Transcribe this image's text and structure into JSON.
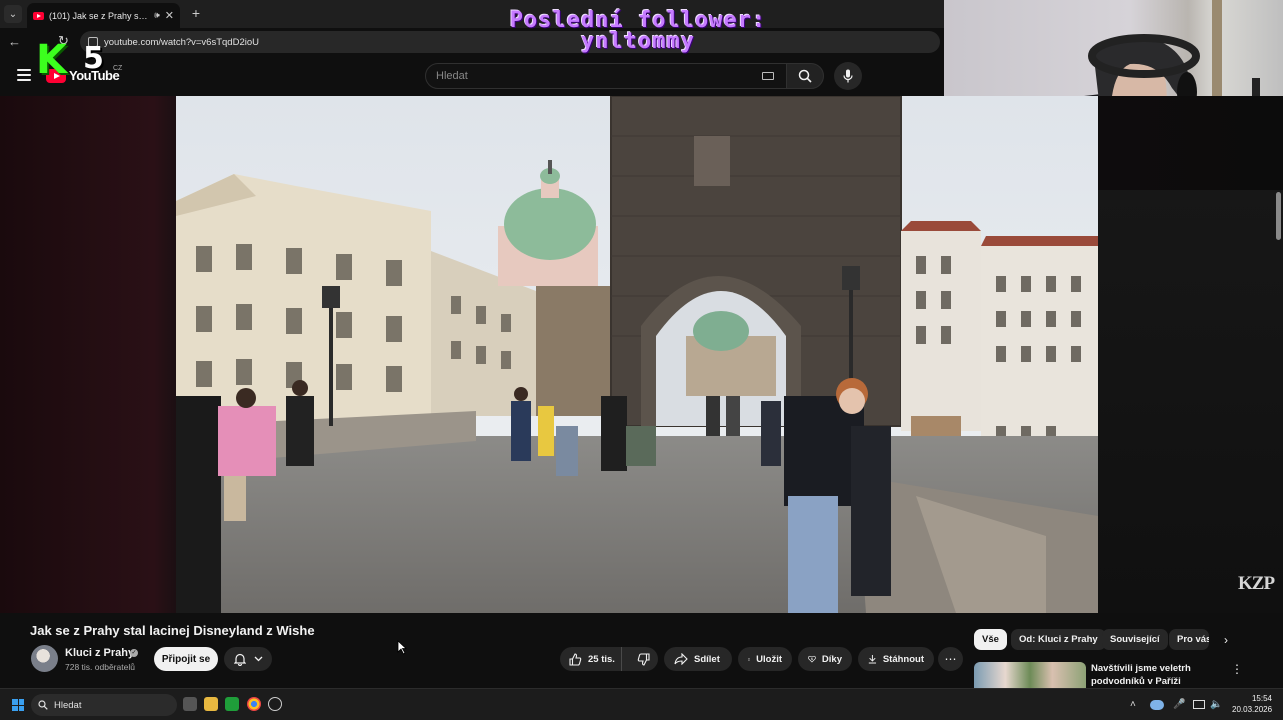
{
  "browser": {
    "tab": {
      "title": "(101) Jak se z Prahy stal lacinej Disneyland z Wishe"
    },
    "url": "youtube.com/watch?v=v6sTqdD2ioU"
  },
  "youtube": {
    "logo_text": "YouTube",
    "region": "CZ",
    "search_placeholder": "Hledat"
  },
  "overlay": {
    "k5_letters": [
      "K",
      "5"
    ],
    "follower_line1": "Poslední follower:",
    "follower_line2": "ynltommy"
  },
  "video": {
    "watermark": "KZP",
    "title": "Jak se z Prahy stal lacinej Disneyland z Wishe"
  },
  "channel": {
    "name": "Kluci z Prahy",
    "subscribers": "728 tis. odběratelů",
    "join_label": "Připojit se"
  },
  "actions": {
    "likes": "25 tis.",
    "share": "Sdílet",
    "save": "Uložit",
    "thanks": "Díky",
    "download": "Stáhnout"
  },
  "chips": [
    "Vše",
    "Od: Kluci z Prahy",
    "Související",
    "Pro vás"
  ],
  "recommendation": {
    "title": "Navštívili jsme veletrh podvodníků v Paříži"
  },
  "taskbar": {
    "search_placeholder": "Hledat",
    "time": "15:54",
    "date": "20.03.2026"
  },
  "colors": {
    "k5_green": "#3cff1e",
    "follower_purple": "#c67bff",
    "yt_red": "#ff0033",
    "background": "#0f0f0f"
  }
}
